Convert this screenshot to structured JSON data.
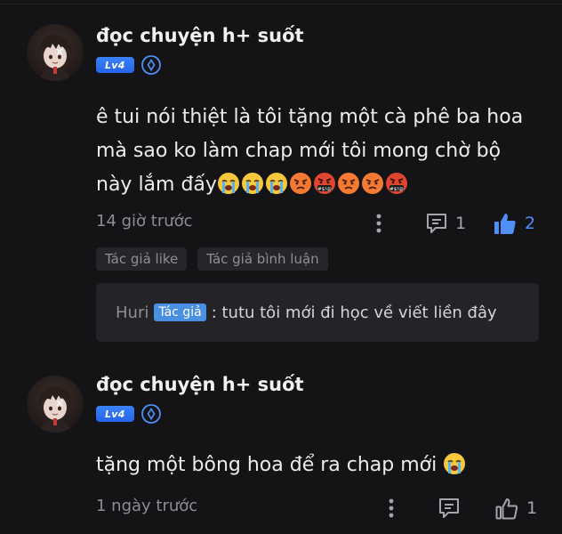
{
  "comments": [
    {
      "username": "đọc chuyện h+ suốt",
      "level": "Lv4",
      "content": "ê tui nói thiệt là tôi tặng một cà phê ba hoa mà sao ko làm chap mới tôi mong chờ bộ này lắm đấy",
      "content_emojis": [
        "crying-face",
        "crying-face",
        "crying-face",
        "angry-face",
        "cursing-face",
        "angry-face",
        "angry-face",
        "cursing-face"
      ],
      "time": "14 giờ trước",
      "reply_count": "1",
      "like_count": "2",
      "liked": true,
      "tags": [
        "Tác giả like",
        "Tác giả bình luận"
      ],
      "reply": {
        "name": "Huri",
        "badge": "Tác giả",
        "text": ": tutu tôi mới đi học về viết liền đây"
      }
    },
    {
      "username": "đọc chuyện h+ suốt",
      "level": "Lv4",
      "content": "tặng một bông hoa để ra chap mới",
      "content_emojis": [
        "crying-face"
      ],
      "time": "1 ngày trước",
      "like_count": "1",
      "liked": false
    }
  ],
  "colors": {
    "background": "#141416",
    "accent_blue": "#4f8ff7",
    "level_badge": "#2563eb",
    "tag_bg": "#26262a",
    "reply_box_bg": "#242428"
  }
}
